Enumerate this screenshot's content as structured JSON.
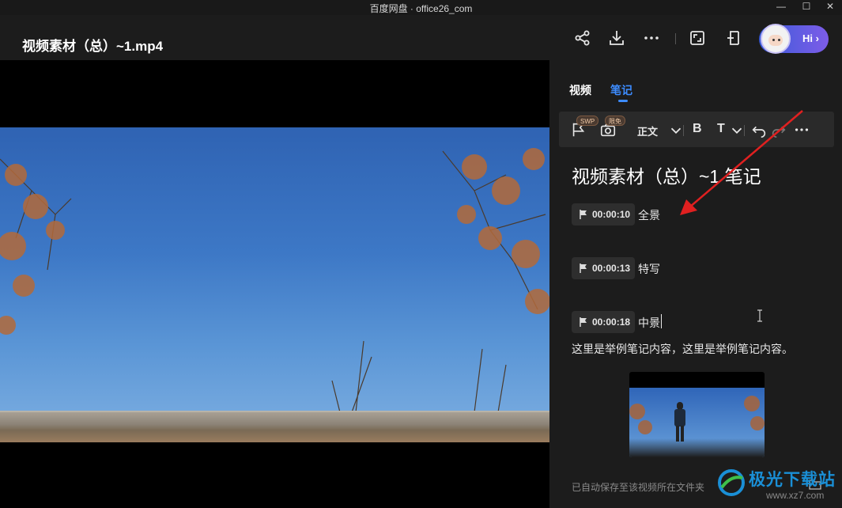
{
  "window": {
    "title": "百度网盘 · office26_com",
    "controls": {
      "minimize": "—",
      "maximize": "☐",
      "close": "✕"
    }
  },
  "header": {
    "file_title": "视频素材（总）~1.mp4",
    "icons": [
      "share-icon",
      "download-icon",
      "more-icon",
      "crop-screen-icon",
      "pip-icon"
    ],
    "assistant": {
      "label": "Hi",
      "chevron": "›"
    }
  },
  "sidebar": {
    "tabs": [
      {
        "label": "视频",
        "active": false
      },
      {
        "label": "笔记",
        "active": true
      }
    ],
    "toolbar": {
      "flag_badge": "SWP",
      "camera_badge": "限免",
      "text_style": "正文",
      "bold": "B",
      "font": "T"
    },
    "note_title": "视频素材（总）~1 笔记",
    "timestamps": [
      {
        "time": "00:00:10",
        "label": "全景"
      },
      {
        "time": "00:00:13",
        "label": "特写"
      },
      {
        "time": "00:00:18",
        "label": "中景"
      }
    ],
    "note_body": "这里是举例笔记内容，这里是举例笔记内容。",
    "autosave": "已自动保存至该视频所在文件夹"
  },
  "watermark": {
    "text": "极光下载站",
    "url": "www.xz7.com"
  },
  "colors": {
    "accent": "#3d8cff",
    "arrow": "#e02020",
    "background": "#1c1c1c"
  }
}
